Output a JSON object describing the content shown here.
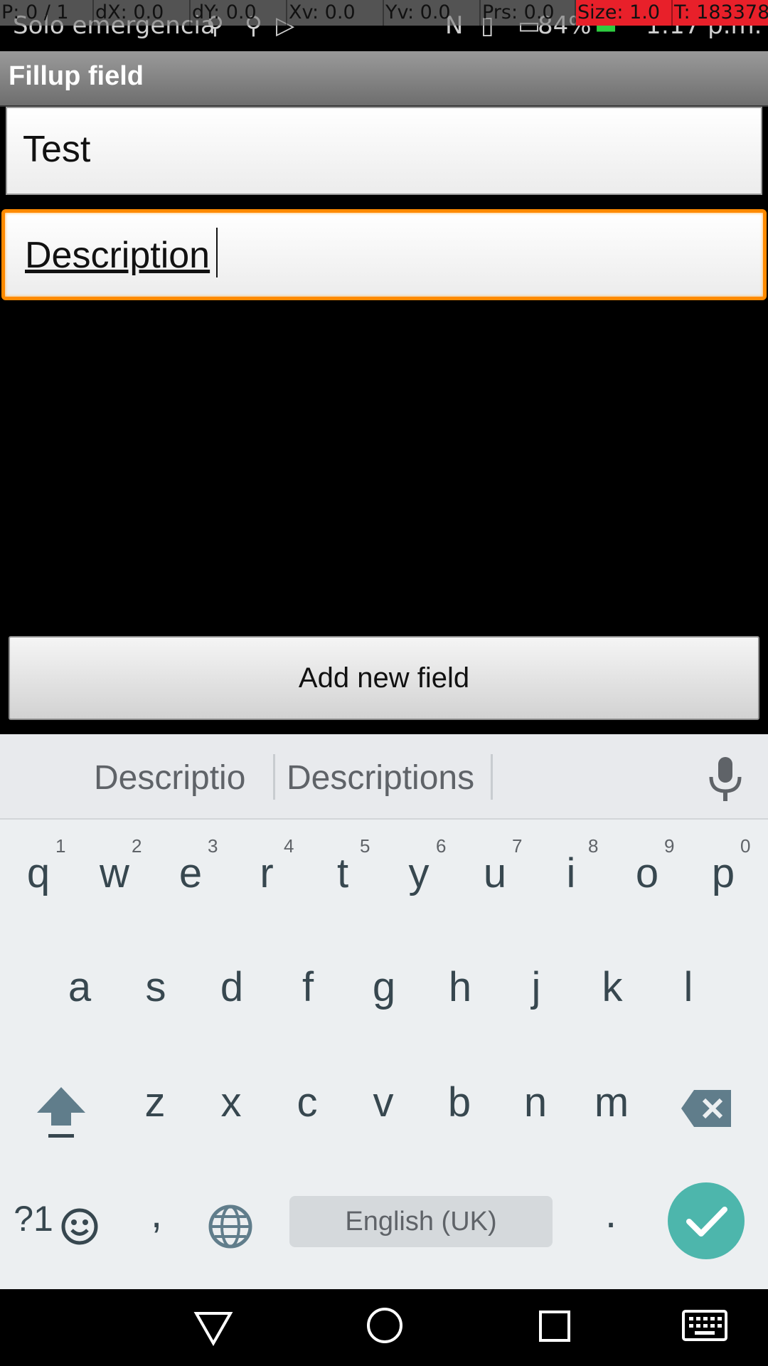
{
  "debug_overlay": {
    "pointer": "P: 0 / 1",
    "dx": "dX: 0.0",
    "dy": "dY: 0.0",
    "xv": "Xv: 0.0",
    "yv": "Yv: 0.0",
    "prs": "Prs: 0.0",
    "size": "Size: 1.0",
    "t": "T: 183378"
  },
  "status_bar": {
    "carrier": "Solo emergencia",
    "battery": "84%",
    "time": "1:17 p.m."
  },
  "app": {
    "title": "Fillup field",
    "fields": [
      {
        "value": "Test",
        "focused": false
      },
      {
        "value": "Description",
        "focused": true
      }
    ],
    "add_button_label": "Add new field"
  },
  "keyboard": {
    "suggestions": [
      "Descriptio",
      "Descriptions"
    ],
    "row1": [
      "q",
      "w",
      "e",
      "r",
      "t",
      "y",
      "u",
      "i",
      "o",
      "p"
    ],
    "row1_hints": [
      "1",
      "2",
      "3",
      "4",
      "5",
      "6",
      "7",
      "8",
      "9",
      "0"
    ],
    "row2": [
      "a",
      "s",
      "d",
      "f",
      "g",
      "h",
      "j",
      "k",
      "l"
    ],
    "row3": [
      "z",
      "x",
      "c",
      "v",
      "b",
      "n",
      "m"
    ],
    "symbols_label": "?1",
    "comma": ",",
    "period": ".",
    "space_label": "English (UK)",
    "accent_color": "#4db6ac"
  },
  "icons": [
    "usb-icon",
    "play-store-icon",
    "nfc-icon",
    "vibrate-icon",
    "battery-icon",
    "mic-icon",
    "shift-icon",
    "backspace-icon",
    "emoji-icon",
    "globe-icon",
    "check-icon",
    "back-icon",
    "home-icon",
    "recents-icon",
    "keyboard-icon"
  ]
}
